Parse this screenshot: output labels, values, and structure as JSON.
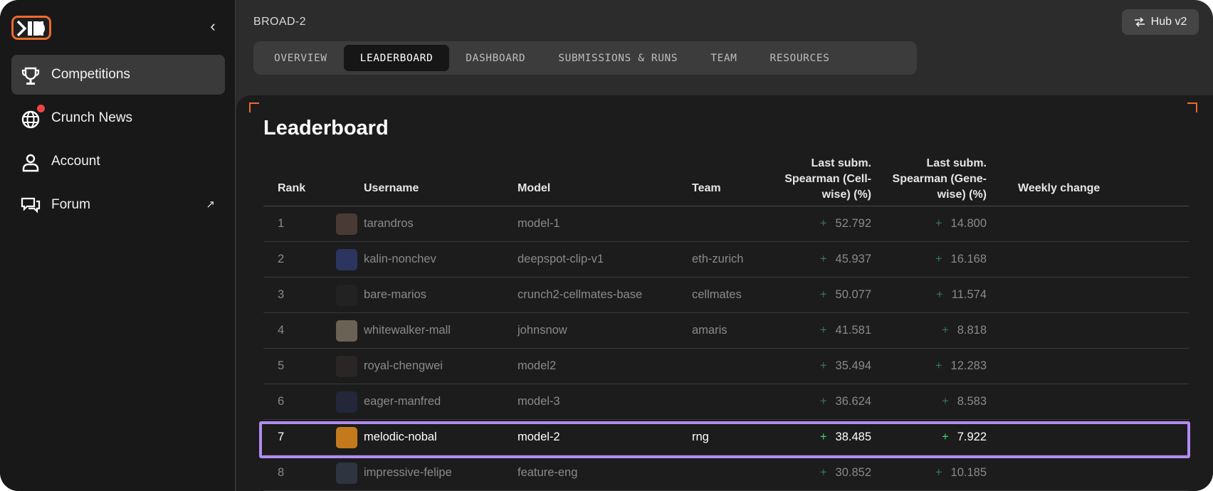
{
  "sidebar": {
    "items": [
      {
        "label": "Competitions",
        "icon": "trophy-icon",
        "active": true
      },
      {
        "label": "Crunch News",
        "icon": "globe-icon",
        "badge": true
      },
      {
        "label": "Account",
        "icon": "user-icon"
      },
      {
        "label": "Forum",
        "icon": "chat-icon",
        "external": true
      }
    ]
  },
  "header": {
    "breadcrumb": "BROAD-2",
    "hub_button": "Hub v2"
  },
  "tabs": [
    {
      "label": "OVERVIEW",
      "active": false
    },
    {
      "label": "LEADERBOARD",
      "active": true
    },
    {
      "label": "DASHBOARD",
      "active": false
    },
    {
      "label": "SUBMISSIONS & RUNS",
      "active": false
    },
    {
      "label": "TEAM",
      "active": false
    },
    {
      "label": "RESOURCES",
      "active": false
    }
  ],
  "leaderboard": {
    "title": "Leaderboard",
    "columns": {
      "rank": "Rank",
      "username": "Username",
      "model": "Model",
      "team": "Team",
      "cell_wise": "Last subm. Spearman (Cell-wise) (%)",
      "gene_wise": "Last subm. Spearman (Gene-wise) (%)",
      "weekly": "Weekly change"
    },
    "rows": [
      {
        "rank": "1",
        "username": "tarandros",
        "model": "model-1",
        "team": "",
        "cell": "52.792",
        "gene": "14.800",
        "avatar": "#4a3a36"
      },
      {
        "rank": "2",
        "username": "kalin-nonchev",
        "model": "deepspot-clip-v1",
        "team": "eth-zurich",
        "cell": "45.937",
        "gene": "16.168",
        "avatar": "#2c3560"
      },
      {
        "rank": "3",
        "username": "bare-marios",
        "model": "crunch2-cellmates-base",
        "team": "cellmates",
        "cell": "50.077",
        "gene": "11.574",
        "avatar": "#222222"
      },
      {
        "rank": "4",
        "username": "whitewalker-mall",
        "model": "johnsnow",
        "team": "amaris",
        "cell": "41.581",
        "gene": "8.818",
        "avatar": "#6b6256"
      },
      {
        "rank": "5",
        "username": "royal-chengwei",
        "model": "model2",
        "team": "",
        "cell": "35.494",
        "gene": "12.283",
        "avatar": "#2a2626"
      },
      {
        "rank": "6",
        "username": "eager-manfred",
        "model": "model-3",
        "team": "",
        "cell": "36.624",
        "gene": "8.583",
        "avatar": "#24263a"
      },
      {
        "rank": "7",
        "username": "melodic-nobal",
        "model": "model-2",
        "team": "rng",
        "cell": "38.485",
        "gene": "7.922",
        "avatar": "#c47a1c",
        "highlight": true
      },
      {
        "rank": "8",
        "username": "impressive-felipe",
        "model": "feature-eng",
        "team": "",
        "cell": "30.852",
        "gene": "10.185",
        "avatar": "#2e3440"
      }
    ]
  },
  "colors": {
    "accent": "#ee6a2a",
    "highlight": "#b18cf0",
    "positive": "#3fcf75",
    "notification": "#f04444"
  }
}
